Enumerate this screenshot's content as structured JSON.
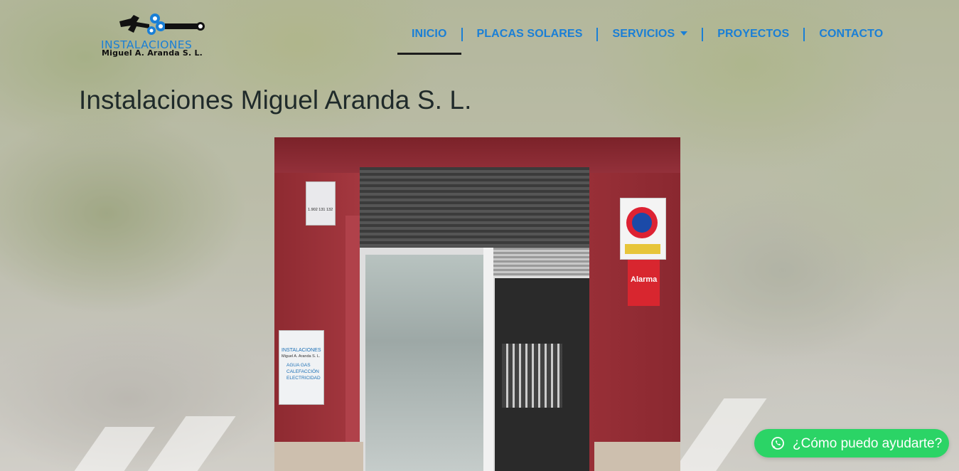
{
  "logo": {
    "line1": "INSTALACIONES",
    "line2": "Miguel A. Aranda S. L."
  },
  "nav": {
    "items": [
      {
        "label": "INICIO",
        "active": true
      },
      {
        "label": "PLACAS SOLARES"
      },
      {
        "label": "SERVICIOS",
        "has_dropdown": true
      },
      {
        "label": "PROYECTOS"
      },
      {
        "label": "CONTACTO"
      }
    ]
  },
  "main": {
    "title": "Instalaciones Miguel Aranda S. L.",
    "photo": {
      "phone_sign": "1.902 131 132",
      "company_sign": {
        "line1": "INSTALACIONES",
        "line2": "Miguel A. Aranda S. L.",
        "services": "AGUA GAS CALEFACCIÓN ELECTRICIDAD"
      },
      "alarm_sign": "Alarma"
    }
  },
  "whatsapp": {
    "label": "¿Cómo puedo ayudarte?",
    "icon": "whatsapp-icon"
  },
  "colors": {
    "accent": "#1a7fd6",
    "whatsapp": "#2bd466",
    "title": "#1f2a2a"
  }
}
